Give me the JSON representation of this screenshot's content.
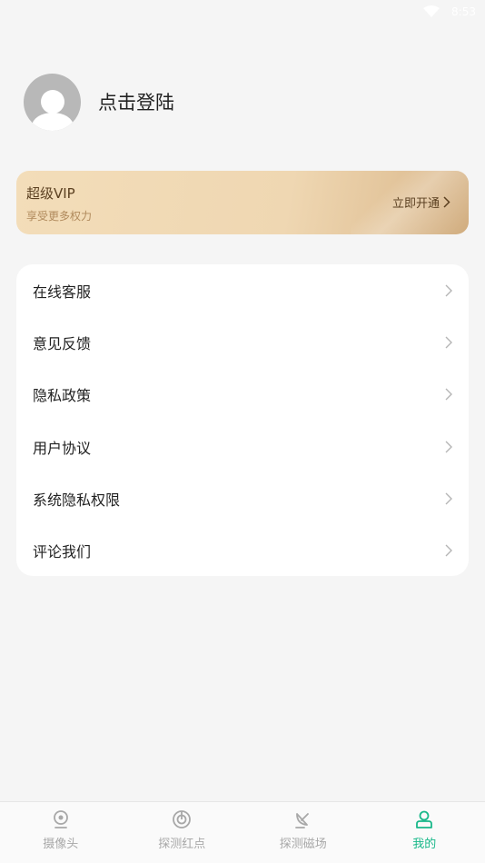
{
  "status_bar": {
    "time": "8:53"
  },
  "profile": {
    "login_text": "点击登陆"
  },
  "vip": {
    "title": "超级VIP",
    "subtitle": "享受更多权力",
    "action": "立即开通"
  },
  "menu": {
    "items": [
      {
        "label": "在线客服"
      },
      {
        "label": "意见反馈"
      },
      {
        "label": "隐私政策"
      },
      {
        "label": "用户协议"
      },
      {
        "label": "系统隐私权限"
      },
      {
        "label": "评论我们"
      }
    ]
  },
  "tabs": [
    {
      "label": "摄像头",
      "icon": "camera-icon",
      "active": false
    },
    {
      "label": "探测红点",
      "icon": "radar-icon",
      "active": false
    },
    {
      "label": "探测磁场",
      "icon": "satellite-dish-icon",
      "active": false
    },
    {
      "label": "我的",
      "icon": "user-icon",
      "active": true
    }
  ],
  "colors": {
    "accent": "#19b88a",
    "vip_text": "#5b4021",
    "vip_sub": "#b08a5c",
    "inactive": "#a8a8a8"
  }
}
